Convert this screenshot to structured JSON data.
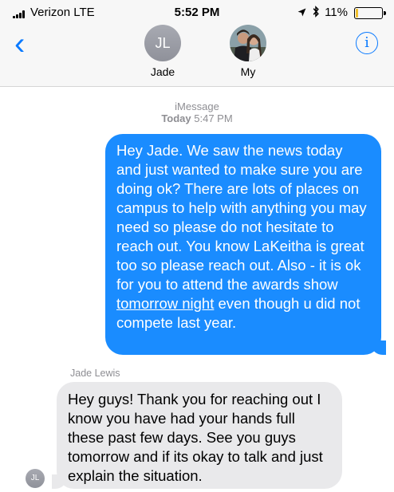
{
  "status_bar": {
    "carrier": "Verizon",
    "network": "LTE",
    "time": "5:52 PM",
    "battery": "11%",
    "battery_level": 0.11,
    "icons": [
      "signal-bars-icon",
      "location-arrow-icon",
      "bluetooth-icon",
      "battery-icon"
    ]
  },
  "header": {
    "back_icon": "chevron-left-icon",
    "info_icon": "info-icon",
    "participants": [
      {
        "initials": "JL",
        "name": "Jade"
      },
      {
        "name": "My",
        "photo": true
      }
    ]
  },
  "conversation": {
    "service": "iMessage",
    "date_label": "Today",
    "time": "5:47 PM",
    "messages": [
      {
        "direction": "outgoing",
        "text_before": "Hey Jade. We saw the news today and just wanted to make sure you are doing ok?  There are lots of places on campus to help with anything you may need so please do not hesitate to reach out.  You know LaKeitha is great too so please reach out.  Also - it is ok for you to attend the awards show ",
        "link": "tomorrow night",
        "text_after": " even though u did not compete last year."
      },
      {
        "direction": "incoming",
        "sender": "Jade Lewis",
        "avatar_initials": "JL",
        "text": "Hey guys! Thank you for reaching out I know you have had your hands full these past few days. See you guys tomorrow and if its okay to talk and just explain the situation."
      }
    ]
  },
  "colors": {
    "accent": "#0a7aff",
    "outgoing_bubble": "#1a8cff",
    "incoming_bubble": "#e9e9eb",
    "battery_low": "#f2c12e"
  }
}
